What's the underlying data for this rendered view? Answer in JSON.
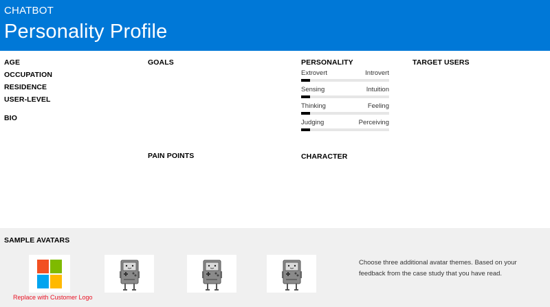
{
  "header": {
    "kicker": "CHATBOT",
    "title": "Personality Profile",
    "background": "#0078d7"
  },
  "profile": {
    "age_label": "AGE",
    "occupation_label": "OCCUPATION",
    "residence_label": "RESIDENCE",
    "user_level_label": "USER-LEVEL",
    "bio_label": "BIO"
  },
  "goals_label": "GOALS",
  "pain_points_label": "PAIN POINTS",
  "personality": {
    "label": "PERSONALITY",
    "traits": [
      {
        "left": "Extrovert",
        "right": "Introvert",
        "level": 0.1
      },
      {
        "left": "Sensing",
        "right": "Intuition",
        "level": 0.1
      },
      {
        "left": "Thinking",
        "right": "Feeling",
        "level": 0.1
      },
      {
        "left": "Judging",
        "right": "Perceiving",
        "level": 0.1
      }
    ]
  },
  "character_label": "CHARACTER",
  "target_users_label": "TARGET USERS",
  "avatars": {
    "label": "SAMPLE AVATARS",
    "logo_caption": "Replace with Customer Logo",
    "logo_icon": "microsoft-logo",
    "avatar_icon": "robot-console",
    "note": "Choose three additional avatar themes.  Based on your feedback from the case study that you have read."
  }
}
